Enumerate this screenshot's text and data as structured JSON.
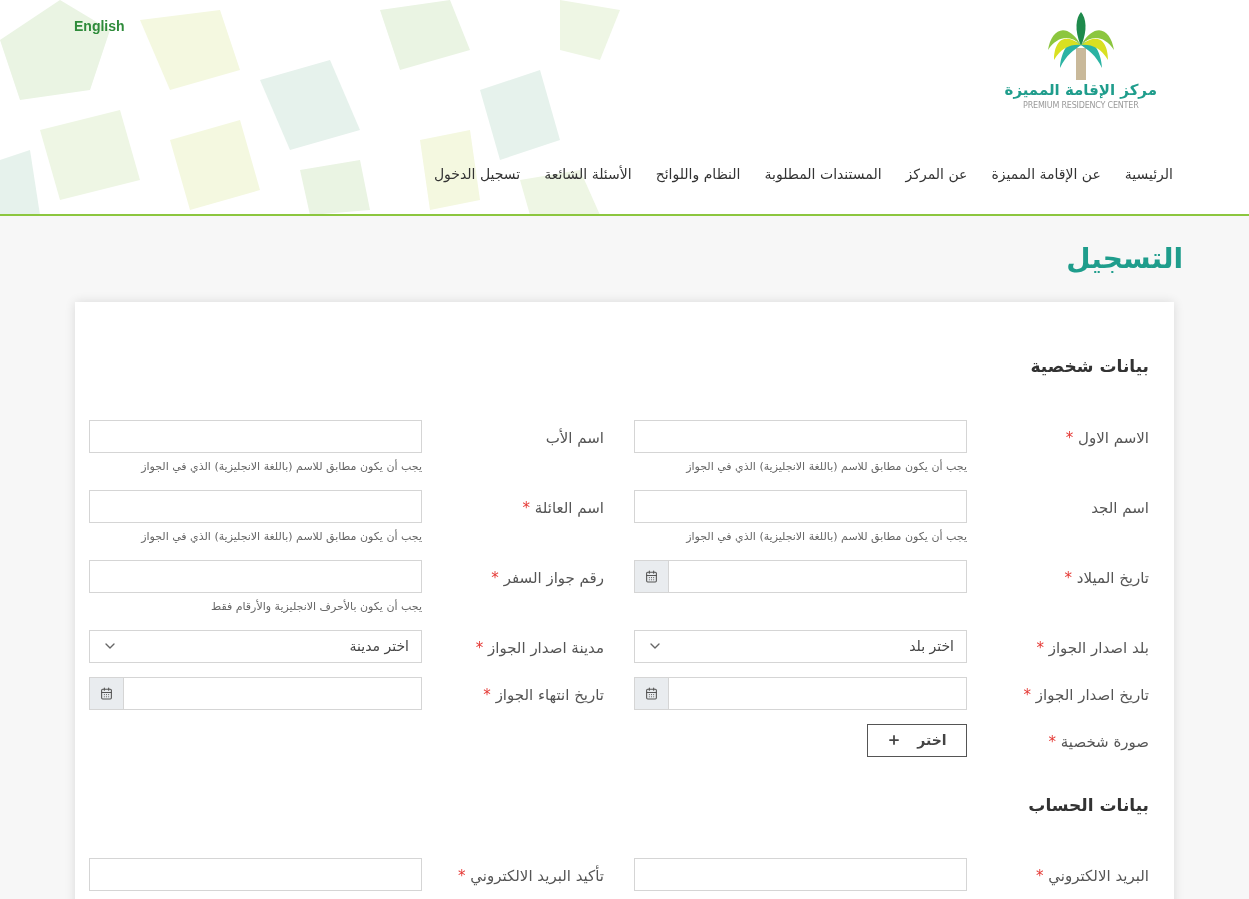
{
  "header": {
    "language_link": "English",
    "logo": {
      "arabic": "مركز الإقامة المميزة",
      "english": "PREMIUM RESIDENCY CENTER"
    },
    "nav": [
      {
        "label": "الرئيسية"
      },
      {
        "label": "عن الإقامة المميزة"
      },
      {
        "label": "عن المركز"
      },
      {
        "label": "المستندات المطلوبة"
      },
      {
        "label": "النظام واللوائح"
      },
      {
        "label": "الأسئلة الشائعة"
      },
      {
        "label": "تسجيل الدخول"
      }
    ]
  },
  "page_title": "التسجيل",
  "sections": [
    {
      "title": "بيانات شخصية",
      "rows": [
        [
          {
            "label": "الاسم الاول",
            "mark": "*",
            "kind": "text",
            "hint": "يجب أن يكون مطابق للاسم (باللغة الانجليزية) الذي في الجواز"
          },
          {
            "label": "اسم الأب",
            "kind": "text",
            "hint": "يجب أن يكون مطابق للاسم (باللغة الانجليزية) الذي في الجواز"
          }
        ],
        [
          {
            "label": "اسم الجد",
            "kind": "text",
            "hint": "يجب أن يكون مطابق للاسم (باللغة الانجليزية) الذي في الجواز"
          },
          {
            "label": "اسم العائلة",
            "mark": "*",
            "kind": "text",
            "hint": "يجب أن يكون مطابق للاسم (باللغة الانجليزية) الذي في الجواز"
          }
        ],
        [
          {
            "label": "تاريخ الميلاد",
            "mark": "*",
            "kind": "date"
          },
          {
            "label": "رقم جواز السفر",
            "mark": "*",
            "kind": "text",
            "hint": "يجب أن يكون بالأحرف الانجليزية والأرقام فقط"
          }
        ],
        [
          {
            "label": "بلد اصدار الجواز",
            "mark": "*",
            "kind": "select",
            "value": "اختر بلد"
          },
          {
            "label": "مدينة اصدار الجواز",
            "mark": "*",
            "kind": "select",
            "value": "اختر مدينة"
          }
        ],
        [
          {
            "label": "تاريخ اصدار الجواز",
            "mark": "*",
            "kind": "date"
          },
          {
            "label": "تاريخ انتهاء الجواز",
            "mark": "*",
            "kind": "date"
          }
        ],
        [
          {
            "label": "صورة شخصية",
            "mark": "*",
            "kind": "file",
            "button": "اختر"
          }
        ]
      ]
    },
    {
      "title": "بيانات الحساب",
      "rows": [
        [
          {
            "label": "البريد الالكتروني",
            "mark": "*",
            "kind": "text"
          },
          {
            "label": "تأكيد البريد الالكتروني",
            "mark": "*",
            "kind": "text"
          }
        ]
      ]
    }
  ]
}
